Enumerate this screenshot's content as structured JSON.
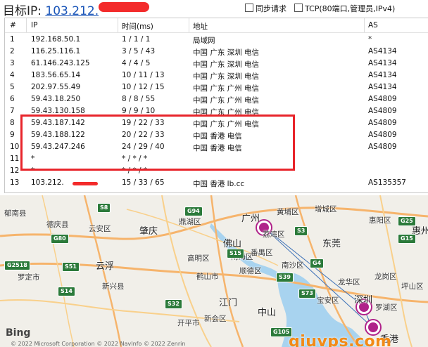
{
  "header": {
    "title_label": "目标IP:",
    "title_ip": "103.212.",
    "options": [
      {
        "label": "同步请求",
        "checked": false
      },
      {
        "label": "TCP(80端口,管理员,IPv4)",
        "checked": false
      }
    ]
  },
  "table": {
    "columns": [
      "#",
      "IP",
      "时间(ms)",
      "地址",
      "AS"
    ],
    "rows": [
      {
        "n": "1",
        "ip": "192.168.50.1",
        "time": "1 / 1 / 1",
        "addr": "局域网",
        "as": "*"
      },
      {
        "n": "2",
        "ip": "116.25.116.1",
        "time": "3 / 5 / 43",
        "addr": "中国 广东 深圳 电信",
        "as": "AS4134"
      },
      {
        "n": "3",
        "ip": "61.146.243.125",
        "time": "4 / 4 / 5",
        "addr": "中国 广东 深圳 电信",
        "as": "AS4134"
      },
      {
        "n": "4",
        "ip": "183.56.65.14",
        "time": "10 / 11 / 13",
        "addr": "中国 广东 深圳 电信",
        "as": "AS4134"
      },
      {
        "n": "5",
        "ip": "202.97.55.49",
        "time": "10 / 12 / 15",
        "addr": "中国 广东 广州 电信",
        "as": "AS4134"
      },
      {
        "n": "6",
        "ip": "59.43.18.250",
        "time": "8 / 8 / 55",
        "addr": "中国 广东 广州 电信",
        "as": "AS4809"
      },
      {
        "n": "7",
        "ip": "59.43.130.158",
        "time": "9 / 9 / 10",
        "addr": "中国 广东 广州 电信",
        "as": "AS4809"
      },
      {
        "n": "8",
        "ip": "59.43.187.142",
        "time": "19 / 22 / 33",
        "addr": "中国 广东 广州 电信",
        "as": "AS4809"
      },
      {
        "n": "9",
        "ip": "59.43.188.122",
        "time": "20 / 22 / 33",
        "addr": "中国 香港 电信",
        "as": "AS4809"
      },
      {
        "n": "10",
        "ip": "59.43.247.246",
        "time": "24 / 29 / 40",
        "addr": "中国 香港 电信",
        "as": "AS4809"
      },
      {
        "n": "11",
        "ip": "*",
        "time": "* / * / *",
        "addr": "",
        "as": ""
      },
      {
        "n": "12",
        "ip": "*",
        "time": "* / * / *",
        "addr": "",
        "as": ""
      },
      {
        "n": "13",
        "ip": "103.212.",
        "time": "15 / 33 / 65",
        "addr": "中国 香港 lb.cc",
        "as": "AS135357"
      }
    ]
  },
  "map": {
    "provider": "Bing",
    "copyright": "© 2022 Microsoft Corporation © 2022 NavInfo © 2022 Zenrin",
    "watermark": "qiuvps.com",
    "labels": [
      {
        "text": "郁南县"
      },
      {
        "text": "德庆县"
      },
      {
        "text": "云安区"
      },
      {
        "text": "肇庆"
      },
      {
        "text": "鼎湖区"
      },
      {
        "text": "广州"
      },
      {
        "text": "黄埔区"
      },
      {
        "text": "增城区"
      },
      {
        "text": "惠阳区"
      },
      {
        "text": "惠州"
      },
      {
        "text": "荔湾区"
      },
      {
        "text": "佛山"
      },
      {
        "text": "番禺区"
      },
      {
        "text": "东莞"
      },
      {
        "text": "云浮"
      },
      {
        "text": "高明区"
      },
      {
        "text": "南海区"
      },
      {
        "text": "罗定市"
      },
      {
        "text": "新兴县"
      },
      {
        "text": "鹤山市"
      },
      {
        "text": "顺德区"
      },
      {
        "text": "南沙区"
      },
      {
        "text": "龙华区"
      },
      {
        "text": "龙岗区"
      },
      {
        "text": "坪山区"
      },
      {
        "text": "江门"
      },
      {
        "text": "中山"
      },
      {
        "text": "宝安区"
      },
      {
        "text": "深圳"
      },
      {
        "text": "罗湖区"
      },
      {
        "text": "开平市"
      },
      {
        "text": "新会区"
      },
      {
        "text": "香港"
      }
    ],
    "shields": [
      {
        "text": "S8"
      },
      {
        "text": "G94"
      },
      {
        "text": "G80"
      },
      {
        "text": "S15"
      },
      {
        "text": "G25"
      },
      {
        "text": "G15"
      },
      {
        "text": "G4"
      },
      {
        "text": "S39"
      },
      {
        "text": "S3"
      },
      {
        "text": "S51"
      },
      {
        "text": "S14"
      },
      {
        "text": "S73"
      },
      {
        "text": "G2518"
      },
      {
        "text": "G105"
      },
      {
        "text": "S32"
      }
    ],
    "accent": "#b0228a"
  },
  "colors": {
    "highlight": "#e8242a",
    "link": "#1a55b8",
    "redaction": "#f32b2b"
  }
}
